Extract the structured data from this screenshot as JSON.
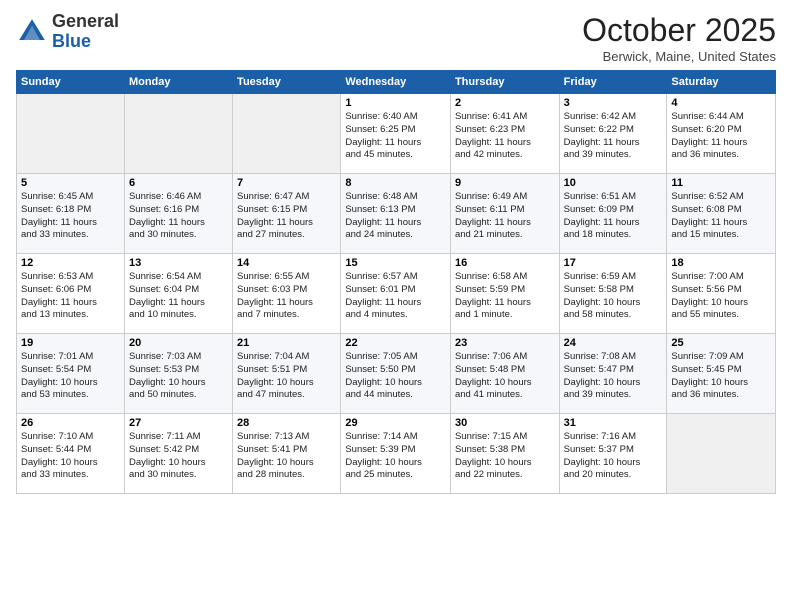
{
  "header": {
    "logo_general": "General",
    "logo_blue": "Blue",
    "month": "October 2025",
    "location": "Berwick, Maine, United States"
  },
  "weekdays": [
    "Sunday",
    "Monday",
    "Tuesday",
    "Wednesday",
    "Thursday",
    "Friday",
    "Saturday"
  ],
  "weeks": [
    [
      {
        "num": "",
        "info": ""
      },
      {
        "num": "",
        "info": ""
      },
      {
        "num": "",
        "info": ""
      },
      {
        "num": "1",
        "info": "Sunrise: 6:40 AM\nSunset: 6:25 PM\nDaylight: 11 hours\nand 45 minutes."
      },
      {
        "num": "2",
        "info": "Sunrise: 6:41 AM\nSunset: 6:23 PM\nDaylight: 11 hours\nand 42 minutes."
      },
      {
        "num": "3",
        "info": "Sunrise: 6:42 AM\nSunset: 6:22 PM\nDaylight: 11 hours\nand 39 minutes."
      },
      {
        "num": "4",
        "info": "Sunrise: 6:44 AM\nSunset: 6:20 PM\nDaylight: 11 hours\nand 36 minutes."
      }
    ],
    [
      {
        "num": "5",
        "info": "Sunrise: 6:45 AM\nSunset: 6:18 PM\nDaylight: 11 hours\nand 33 minutes."
      },
      {
        "num": "6",
        "info": "Sunrise: 6:46 AM\nSunset: 6:16 PM\nDaylight: 11 hours\nand 30 minutes."
      },
      {
        "num": "7",
        "info": "Sunrise: 6:47 AM\nSunset: 6:15 PM\nDaylight: 11 hours\nand 27 minutes."
      },
      {
        "num": "8",
        "info": "Sunrise: 6:48 AM\nSunset: 6:13 PM\nDaylight: 11 hours\nand 24 minutes."
      },
      {
        "num": "9",
        "info": "Sunrise: 6:49 AM\nSunset: 6:11 PM\nDaylight: 11 hours\nand 21 minutes."
      },
      {
        "num": "10",
        "info": "Sunrise: 6:51 AM\nSunset: 6:09 PM\nDaylight: 11 hours\nand 18 minutes."
      },
      {
        "num": "11",
        "info": "Sunrise: 6:52 AM\nSunset: 6:08 PM\nDaylight: 11 hours\nand 15 minutes."
      }
    ],
    [
      {
        "num": "12",
        "info": "Sunrise: 6:53 AM\nSunset: 6:06 PM\nDaylight: 11 hours\nand 13 minutes."
      },
      {
        "num": "13",
        "info": "Sunrise: 6:54 AM\nSunset: 6:04 PM\nDaylight: 11 hours\nand 10 minutes."
      },
      {
        "num": "14",
        "info": "Sunrise: 6:55 AM\nSunset: 6:03 PM\nDaylight: 11 hours\nand 7 minutes."
      },
      {
        "num": "15",
        "info": "Sunrise: 6:57 AM\nSunset: 6:01 PM\nDaylight: 11 hours\nand 4 minutes."
      },
      {
        "num": "16",
        "info": "Sunrise: 6:58 AM\nSunset: 5:59 PM\nDaylight: 11 hours\nand 1 minute."
      },
      {
        "num": "17",
        "info": "Sunrise: 6:59 AM\nSunset: 5:58 PM\nDaylight: 10 hours\nand 58 minutes."
      },
      {
        "num": "18",
        "info": "Sunrise: 7:00 AM\nSunset: 5:56 PM\nDaylight: 10 hours\nand 55 minutes."
      }
    ],
    [
      {
        "num": "19",
        "info": "Sunrise: 7:01 AM\nSunset: 5:54 PM\nDaylight: 10 hours\nand 53 minutes."
      },
      {
        "num": "20",
        "info": "Sunrise: 7:03 AM\nSunset: 5:53 PM\nDaylight: 10 hours\nand 50 minutes."
      },
      {
        "num": "21",
        "info": "Sunrise: 7:04 AM\nSunset: 5:51 PM\nDaylight: 10 hours\nand 47 minutes."
      },
      {
        "num": "22",
        "info": "Sunrise: 7:05 AM\nSunset: 5:50 PM\nDaylight: 10 hours\nand 44 minutes."
      },
      {
        "num": "23",
        "info": "Sunrise: 7:06 AM\nSunset: 5:48 PM\nDaylight: 10 hours\nand 41 minutes."
      },
      {
        "num": "24",
        "info": "Sunrise: 7:08 AM\nSunset: 5:47 PM\nDaylight: 10 hours\nand 39 minutes."
      },
      {
        "num": "25",
        "info": "Sunrise: 7:09 AM\nSunset: 5:45 PM\nDaylight: 10 hours\nand 36 minutes."
      }
    ],
    [
      {
        "num": "26",
        "info": "Sunrise: 7:10 AM\nSunset: 5:44 PM\nDaylight: 10 hours\nand 33 minutes."
      },
      {
        "num": "27",
        "info": "Sunrise: 7:11 AM\nSunset: 5:42 PM\nDaylight: 10 hours\nand 30 minutes."
      },
      {
        "num": "28",
        "info": "Sunrise: 7:13 AM\nSunset: 5:41 PM\nDaylight: 10 hours\nand 28 minutes."
      },
      {
        "num": "29",
        "info": "Sunrise: 7:14 AM\nSunset: 5:39 PM\nDaylight: 10 hours\nand 25 minutes."
      },
      {
        "num": "30",
        "info": "Sunrise: 7:15 AM\nSunset: 5:38 PM\nDaylight: 10 hours\nand 22 minutes."
      },
      {
        "num": "31",
        "info": "Sunrise: 7:16 AM\nSunset: 5:37 PM\nDaylight: 10 hours\nand 20 minutes."
      },
      {
        "num": "",
        "info": ""
      }
    ]
  ]
}
